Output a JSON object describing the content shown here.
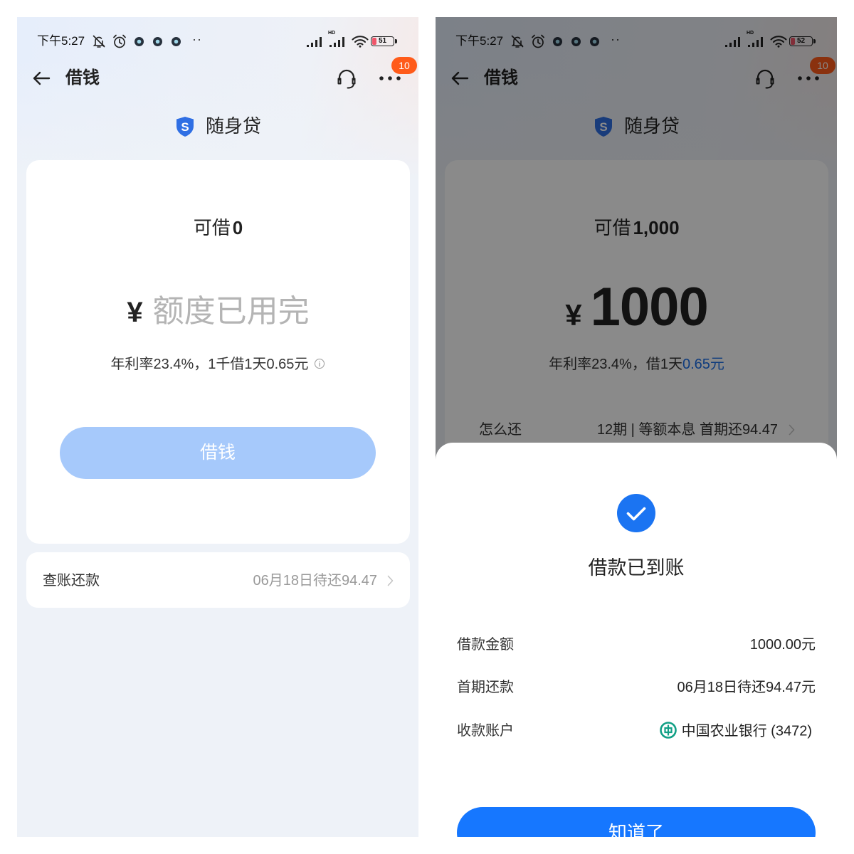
{
  "left": {
    "status_bar": {
      "time": "下午5:27",
      "more": "··",
      "hd": "HD",
      "battery": "51"
    },
    "header": {
      "title": "借钱",
      "badge": "10"
    },
    "brand": {
      "logo_letter": "S",
      "name": "随身贷"
    },
    "loan_card": {
      "available_label": "可借",
      "available_amount": "0",
      "currency": "¥",
      "amount_text": "额度已用完",
      "rate_text": "年利率23.4%，1千借1天0.65元",
      "borrow_button": "借钱"
    },
    "repay_card": {
      "label": "查账还款",
      "value": "06月18日待还94.47"
    }
  },
  "right": {
    "status_bar": {
      "time": "下午5:27",
      "more": "··",
      "hd": "HD",
      "battery": "52"
    },
    "header": {
      "title": "借钱",
      "badge": "10"
    },
    "brand": {
      "logo_letter": "S",
      "name": "随身贷"
    },
    "loan_card": {
      "available_label": "可借",
      "available_amount": "1,000",
      "currency": "¥",
      "amount": "1000",
      "rate_prefix": "年利率23.4%，借1天",
      "rate_highlight": "0.65元",
      "repay_label": "怎么还",
      "repay_plan": "12期 | 等额本息 首期还94.47"
    },
    "success_sheet": {
      "title": "借款已到账",
      "rows": [
        {
          "label": "借款金额",
          "value": "1000.00元"
        },
        {
          "label": "首期还款",
          "value": "06月18日待还94.47元"
        },
        {
          "label": "收款账户",
          "value": "中国农业银行 (3472)"
        }
      ],
      "confirm_button": "知道了"
    }
  },
  "colors": {
    "primary_blue": "#1677ff",
    "disabled_button": "#a6c9fb",
    "badge_orange": "#ff5b1a",
    "rate_highlight": "#1d6fe8",
    "brand_shield": "#2f6fe4",
    "bank_green": "#12a086",
    "page_background": "#eef2f8"
  },
  "icons": [
    "arrow-left-icon",
    "headset-icon",
    "more-dots-icon",
    "shield-logo-icon",
    "info-icon",
    "chevron-right-icon",
    "check-circle-icon",
    "bank-logo-icon",
    "mute-icon",
    "alarm-icon",
    "signal-icon",
    "wifi-icon",
    "battery-icon"
  ]
}
